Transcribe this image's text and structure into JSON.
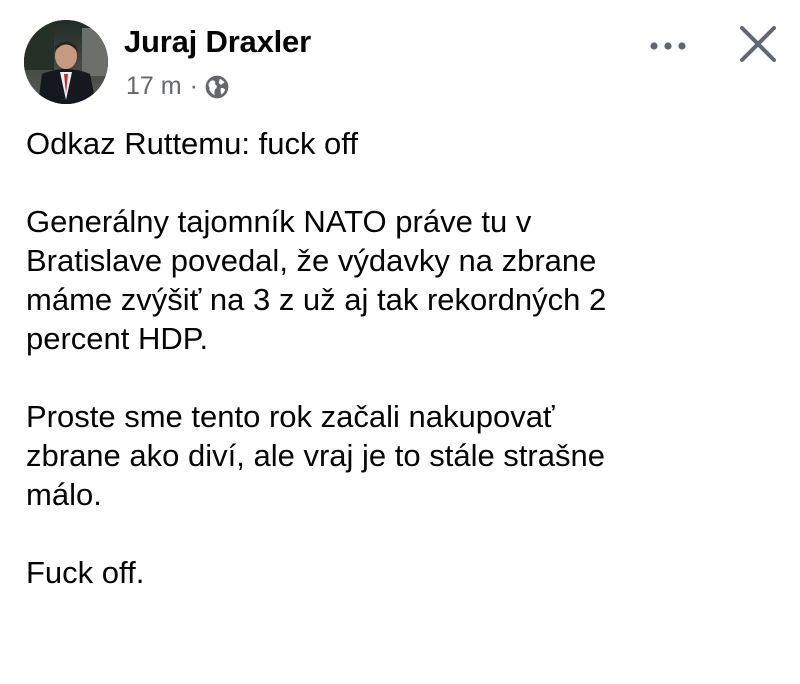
{
  "post": {
    "author": "Juraj Draxler",
    "time": "17 m",
    "separator": "·",
    "visibility_icon": "globe-icon",
    "more_icon": "more-options-icon",
    "close_icon": "close-icon",
    "paragraphs": [
      [
        "Odkaz Ruttemu: fuck off"
      ],
      [
        "Generálny tajomník NATO práve tu v",
        "Bratislave povedal, že výdavky na zbrane",
        "máme zvýšiť na 3 z už aj tak rekordných 2",
        "percent HDP."
      ],
      [
        "Proste sme tento rok začali nakupovať",
        "zbrane ako diví, ale vraj je to stále strašne",
        "málo."
      ],
      [
        "Fuck off."
      ]
    ]
  },
  "colors": {
    "text": "#050505",
    "meta": "#65676b",
    "icon": "#606770"
  }
}
